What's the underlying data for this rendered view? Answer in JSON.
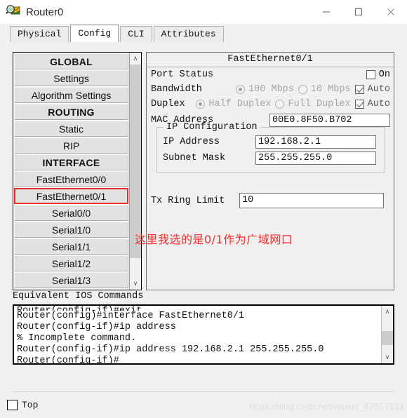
{
  "window": {
    "title": "Router0",
    "icon": "packet-tracer-router-icon",
    "controls": {
      "minimize": "—",
      "maximize": "☐",
      "close": "✕"
    }
  },
  "tabs": [
    {
      "label": "Physical",
      "active": false
    },
    {
      "label": "Config",
      "active": true
    },
    {
      "label": "CLI",
      "active": false
    },
    {
      "label": "Attributes",
      "active": false
    }
  ],
  "sidebar": {
    "items": [
      {
        "label": "GLOBAL",
        "type": "header"
      },
      {
        "label": "Settings",
        "type": "item"
      },
      {
        "label": "Algorithm Settings",
        "type": "item"
      },
      {
        "label": "ROUTING",
        "type": "header"
      },
      {
        "label": "Static",
        "type": "item"
      },
      {
        "label": "RIP",
        "type": "item"
      },
      {
        "label": "INTERFACE",
        "type": "header"
      },
      {
        "label": "FastEthernet0/0",
        "type": "item"
      },
      {
        "label": "FastEthernet0/1",
        "type": "item",
        "selected": true
      },
      {
        "label": "Serial0/0",
        "type": "item"
      },
      {
        "label": "Serial1/0",
        "type": "item"
      },
      {
        "label": "Serial1/1",
        "type": "item"
      },
      {
        "label": "Serial1/2",
        "type": "item"
      },
      {
        "label": "Serial1/3",
        "type": "item"
      }
    ],
    "scroll_up": "∧",
    "scroll_down": "∨"
  },
  "config": {
    "title": "FastEthernet0/1",
    "port_status": {
      "label": "Port Status",
      "checkbox_label": "On",
      "checked": false
    },
    "bandwidth": {
      "label": "Bandwidth",
      "option_100": "100 Mbps",
      "option_10": "10 Mbps",
      "selected": "100 Mbps",
      "auto_label": "Auto",
      "auto_checked": true
    },
    "duplex": {
      "label": "Duplex",
      "option_half": "Half Duplex",
      "option_full": "Full Duplex",
      "selected": "Half Duplex",
      "auto_label": "Auto",
      "auto_checked": true
    },
    "mac_address": {
      "label": "MAC Address",
      "value": "00E0.8F50.B702"
    },
    "ip_configuration": {
      "legend": "IP Configuration",
      "ip_address_label": "IP Address",
      "ip_address_value": "192.168.2.1",
      "subnet_mask_label": "Subnet Mask",
      "subnet_mask_value": "255.255.255.0"
    },
    "tx_ring_limit": {
      "label": "Tx Ring Limit",
      "value": "10"
    }
  },
  "annotation": {
    "text": "这里我选的是0/1作为广域网口",
    "color": "#f52a2a"
  },
  "ios": {
    "label": "Equivalent IOS Commands",
    "lines": [
      "Router(config-if)#exit",
      "Router(config)#interface FastEthernet0/1",
      "Router(config-if)#ip address",
      "% Incomplete command.",
      "Router(config-if)#ip address 192.168.2.1 255.255.255.0",
      "Router(config-if)#"
    ],
    "scroll_up": "∧",
    "scroll_down": "∨"
  },
  "footer": {
    "top_label": "Top",
    "top_checked": false,
    "watermark": "https://blog.csdn.net/weixin_47357131"
  }
}
